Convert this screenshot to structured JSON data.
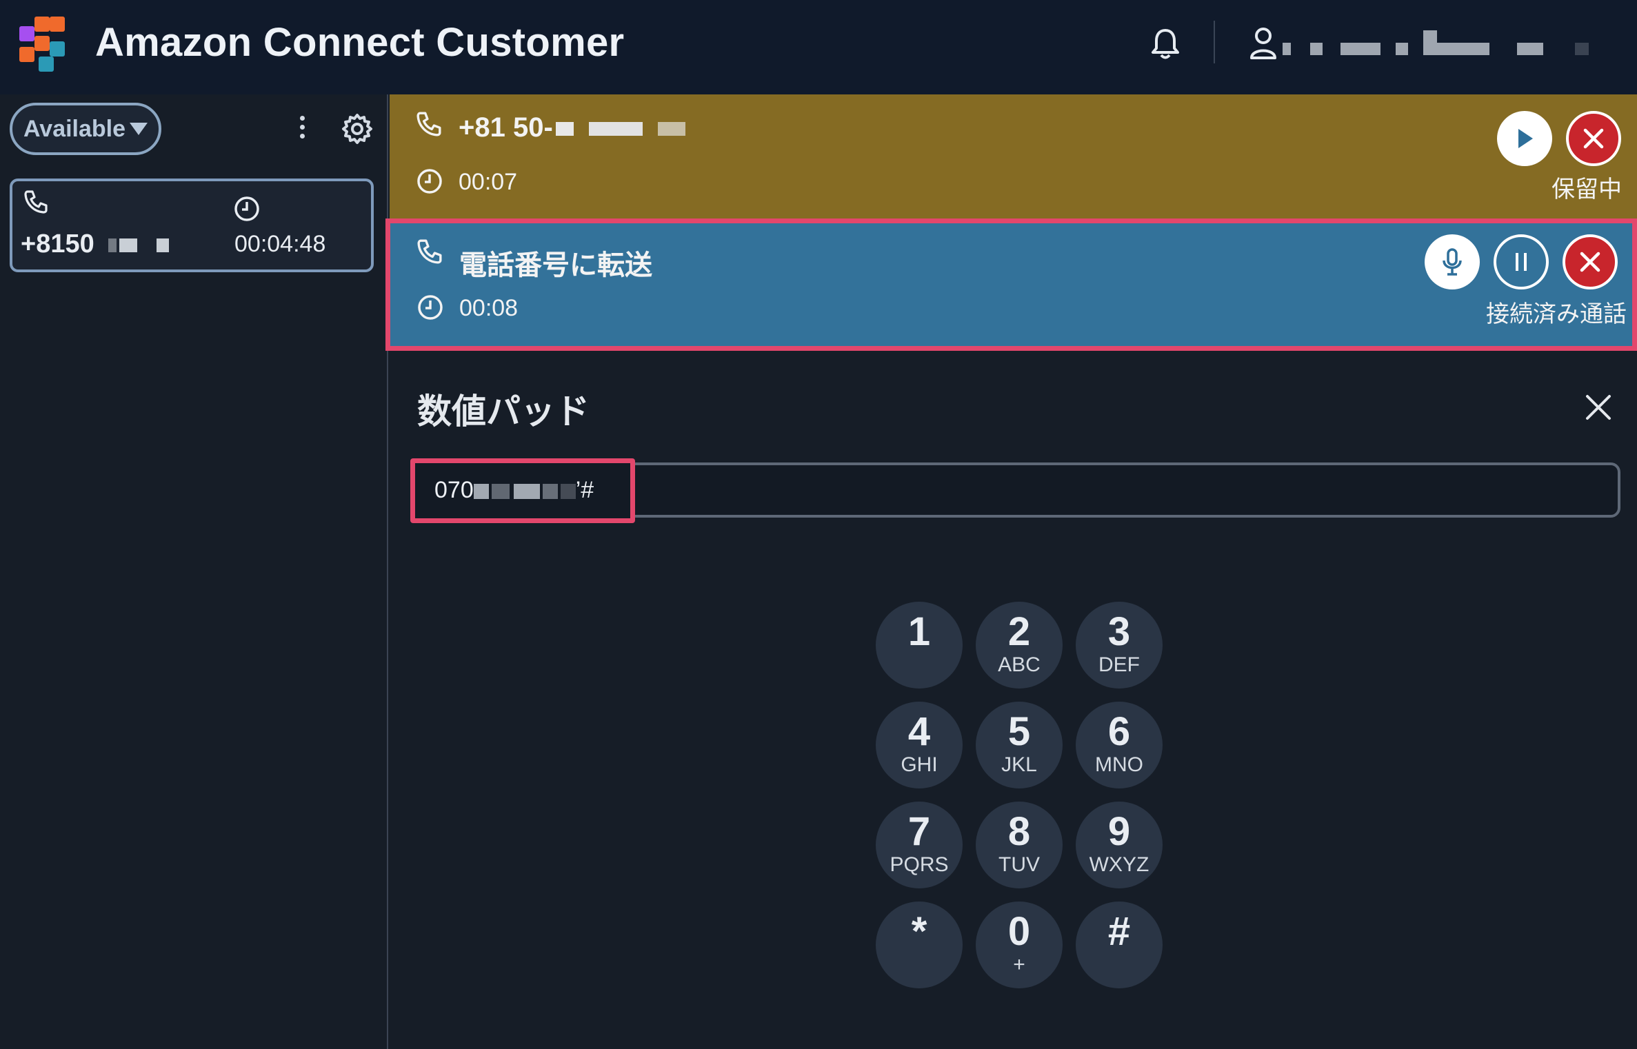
{
  "header": {
    "app_title": "Amazon Connect Customer"
  },
  "sidebar": {
    "status": "Available",
    "contact": {
      "phone": "+8150",
      "timer": "00:04:48"
    }
  },
  "held_call": {
    "phone": "+81 50-",
    "timer": "00:07",
    "state_label": "保留中"
  },
  "connected_call": {
    "title": "電話番号に転送",
    "timer": "00:08",
    "state_label": "接続済み通話"
  },
  "numpad": {
    "title": "数値パッド",
    "input_prefix": "070",
    "input_suffix": "’#",
    "keys": [
      {
        "digit": "1",
        "letters": ""
      },
      {
        "digit": "2",
        "letters": "ABC"
      },
      {
        "digit": "3",
        "letters": "DEF"
      },
      {
        "digit": "4",
        "letters": "GHI"
      },
      {
        "digit": "5",
        "letters": "JKL"
      },
      {
        "digit": "6",
        "letters": "MNO"
      },
      {
        "digit": "7",
        "letters": "PQRS"
      },
      {
        "digit": "8",
        "letters": "TUV"
      },
      {
        "digit": "9",
        "letters": "WXYZ"
      },
      {
        "digit": "*",
        "letters": ""
      },
      {
        "digit": "0",
        "letters": "+"
      },
      {
        "digit": "#",
        "letters": ""
      }
    ]
  },
  "colors": {
    "header_bg": "#101a2b",
    "held_bg": "#856b23",
    "connected_bg": "#33729a",
    "highlight_border": "#e3476c",
    "end_call_red": "#c8252c"
  }
}
